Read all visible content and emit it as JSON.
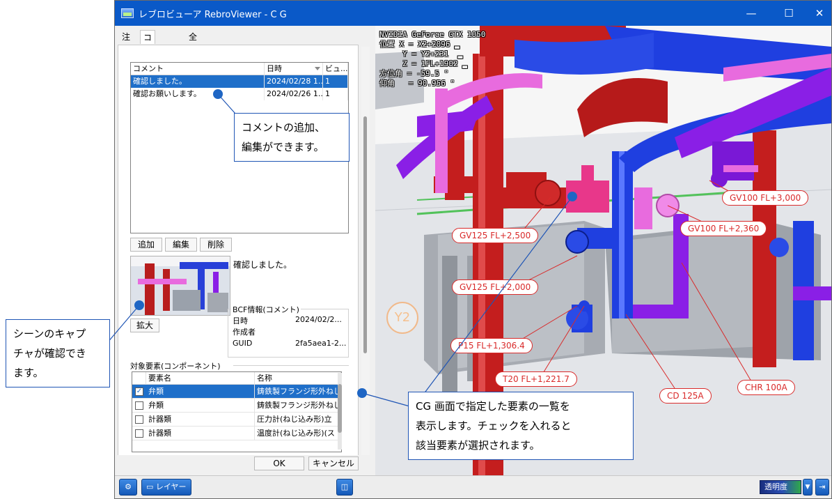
{
  "window": {
    "title": "レブロビューア RebroViewer - C G",
    "controls": {
      "minimize": "—",
      "maximize": "☐",
      "close": "✕"
    }
  },
  "tabs": [
    "注記",
    "コメント",
    "全天球画像"
  ],
  "comment_list": {
    "columns": [
      "コメント",
      "日時",
      "ビュ..."
    ],
    "rows": [
      {
        "comment": "確認しました。",
        "date": "2024/02/28 1...",
        "view": "1"
      },
      {
        "comment": "確認お願いします。",
        "date": "2024/02/26 1...",
        "view": "1"
      }
    ]
  },
  "buttons": {
    "add": "追加",
    "edit": "編集",
    "delete": "削除",
    "zoom": "拡大",
    "ok": "OK",
    "cancel": "キャンセル"
  },
  "selected_comment_text": "確認しました。",
  "bcf": {
    "title": "BCF情報(コメント)",
    "date_label": "日時",
    "date_value": "2024/02/2...",
    "author_label": "作成者",
    "guid_label": "GUID",
    "guid_value": "2fa5aea1-2..."
  },
  "elements": {
    "group_label": "対象要素(コンポーネント)",
    "columns": [
      "要素名",
      "名称"
    ],
    "rows": [
      {
        "checked": true,
        "type": "弁類",
        "name": "鋳鉄製フランジ形外ねじ"
      },
      {
        "checked": false,
        "type": "弁類",
        "name": "鋳鉄製フランジ形外ねじ"
      },
      {
        "checked": false,
        "type": "計器類",
        "name": "圧力計(ねじ込み形)立"
      },
      {
        "checked": false,
        "type": "計器類",
        "name": "温度計(ねじ込み形)(ス"
      }
    ]
  },
  "viewport": {
    "hud": "NVIDIA GeForce GTX 1050\n位置 X = X2+2096 ▂\n     Y = Y2+231  ▂\n     Z = 1FL+1902 ▂\n方位角 = -59.5 °\n仰角   = 90.956 °",
    "grid_marker": "Y2",
    "labels": [
      "GV125 FL+2,500",
      "GV125 FL+2,000",
      "P15 FL+1,306.4",
      "T20 FL+1,221.7",
      "GV100 FL+3,000",
      "GV100 FL+2,360",
      "CD 125A",
      "CHR 100A"
    ]
  },
  "toolbar": {
    "layer": "レイヤー",
    "transparency": "透明度"
  },
  "callouts": {
    "comment": "コメントの追加、\n編集ができます。",
    "capture": "シーンのキャプ\nチャが確認でき\nます。",
    "elements": "CG 画面で指定した要素の一覧を\n表示します。チェックを入れると\n該当要素が選択されます。"
  },
  "colors": {
    "titlebar": "#0a59c8",
    "selection": "#1f6fc9",
    "label_red": "#d92a2a",
    "pipe_red": "#c41e1e",
    "pipe_blue": "#1f3fe0",
    "pipe_purple": "#8a1fe6",
    "pipe_pink": "#e86bde",
    "callout_blue": "#1f55b5"
  }
}
